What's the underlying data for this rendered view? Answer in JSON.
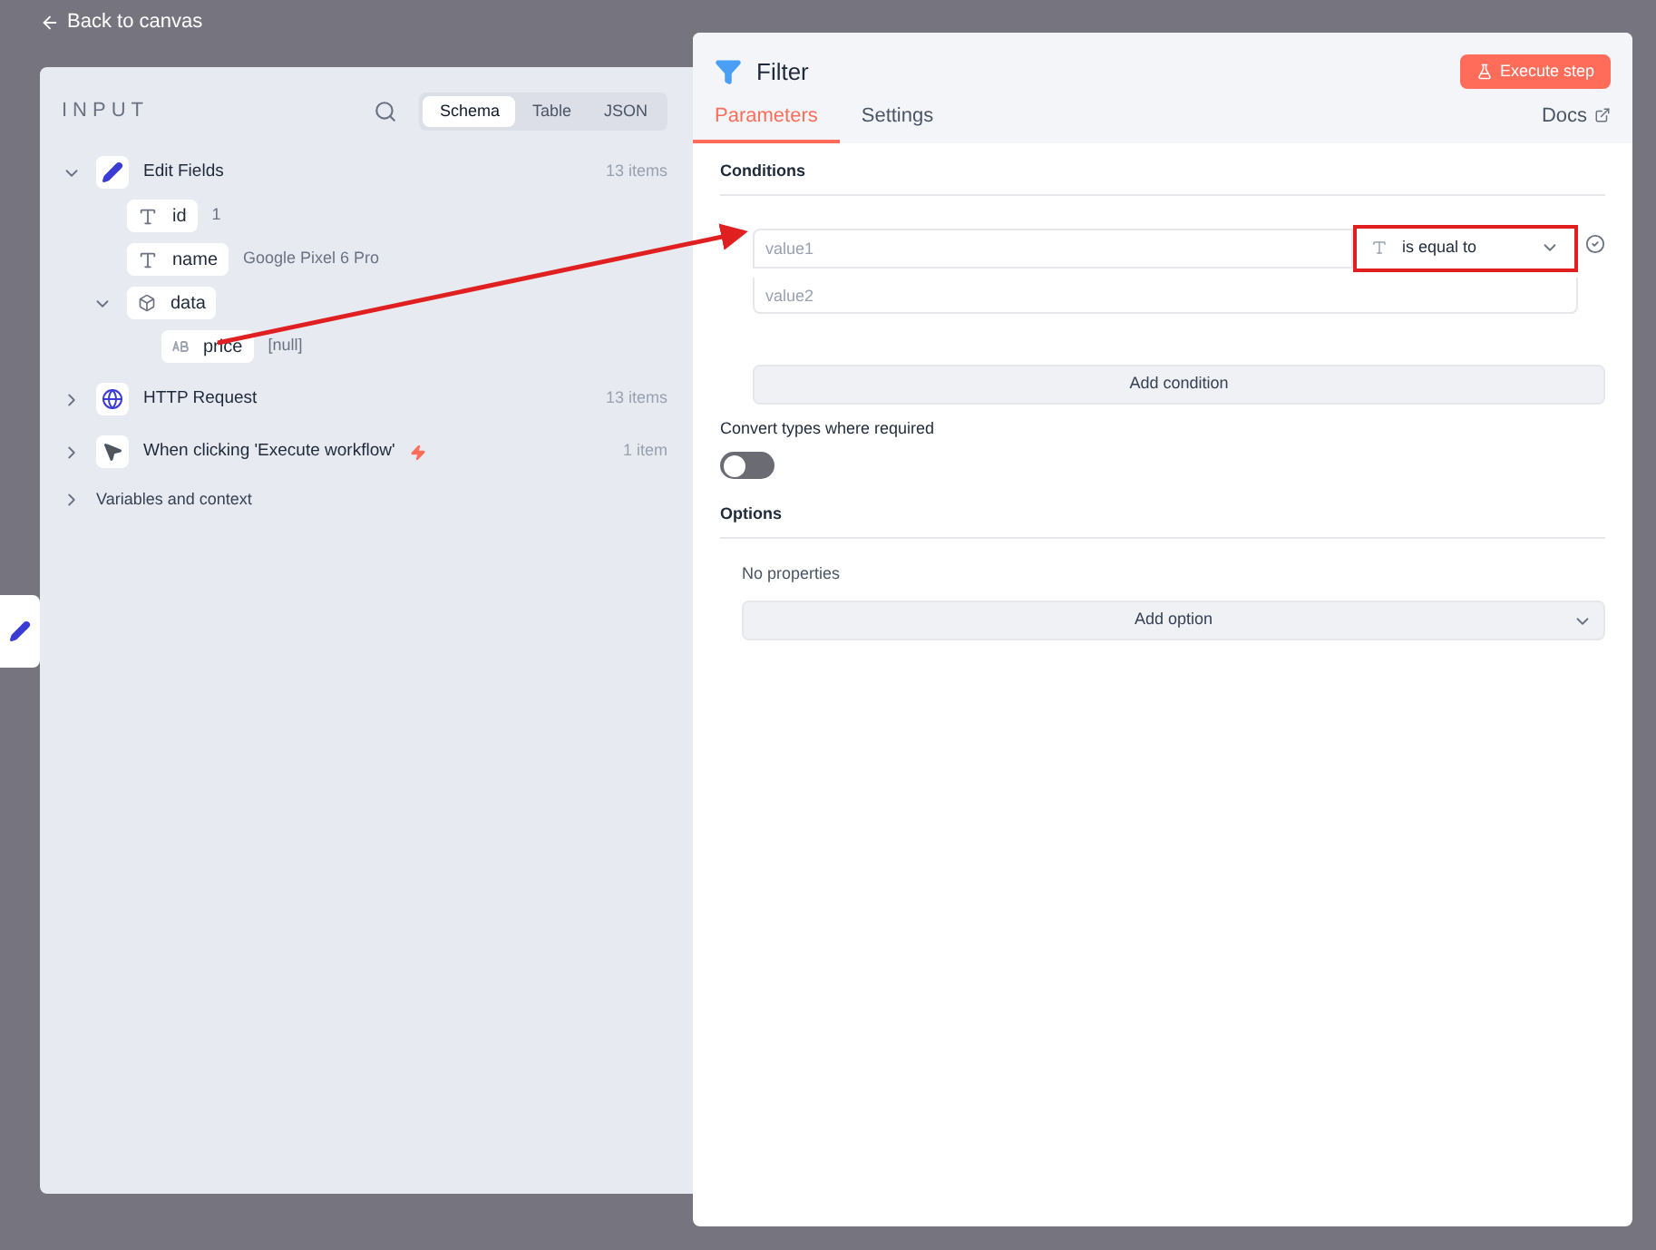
{
  "back_link": "Back to canvas",
  "input_panel": {
    "title": "INPUT",
    "view_tabs": [
      {
        "label": "Schema",
        "selected": true
      },
      {
        "label": "Table",
        "selected": false
      },
      {
        "label": "JSON",
        "selected": false
      }
    ],
    "nodes": [
      {
        "kind": "edit",
        "name": "Edit Fields",
        "count": "13 items",
        "expanded": true,
        "trigger": false,
        "fields": [
          {
            "kind": "text",
            "name": "id",
            "value": "1"
          },
          {
            "kind": "text",
            "name": "name",
            "value": "Google Pixel 6 Pro"
          },
          {
            "kind": "object",
            "name": "data",
            "expanded": true,
            "children": [
              {
                "kind": "string",
                "name": "price",
                "value": "[null]"
              }
            ]
          }
        ]
      },
      {
        "kind": "http",
        "name": "HTTP Request",
        "count": "13 items",
        "expanded": false,
        "trigger": false
      },
      {
        "kind": "cursor",
        "name": "When clicking 'Execute workflow'",
        "count": "1 item",
        "expanded": false,
        "trigger": true
      }
    ],
    "variables": {
      "label": "Variables and context",
      "expanded": false
    }
  },
  "node_panel": {
    "title": "Filter",
    "execute_button": "Execute step",
    "tabs": [
      {
        "label": "Parameters",
        "selected": true
      },
      {
        "label": "Settings",
        "selected": false
      }
    ],
    "docs_link": "Docs",
    "conditions": {
      "label": "Conditions",
      "rows": [
        {
          "value1_placeholder": "value1",
          "operator": "is equal to",
          "operator_highlighted": true,
          "value2_placeholder": "value2"
        }
      ],
      "add_button": "Add condition"
    },
    "convert_types": {
      "label": "Convert types where required",
      "on": false
    },
    "options": {
      "label": "Options",
      "empty_text": "No properties",
      "add_button": "Add option"
    }
  }
}
